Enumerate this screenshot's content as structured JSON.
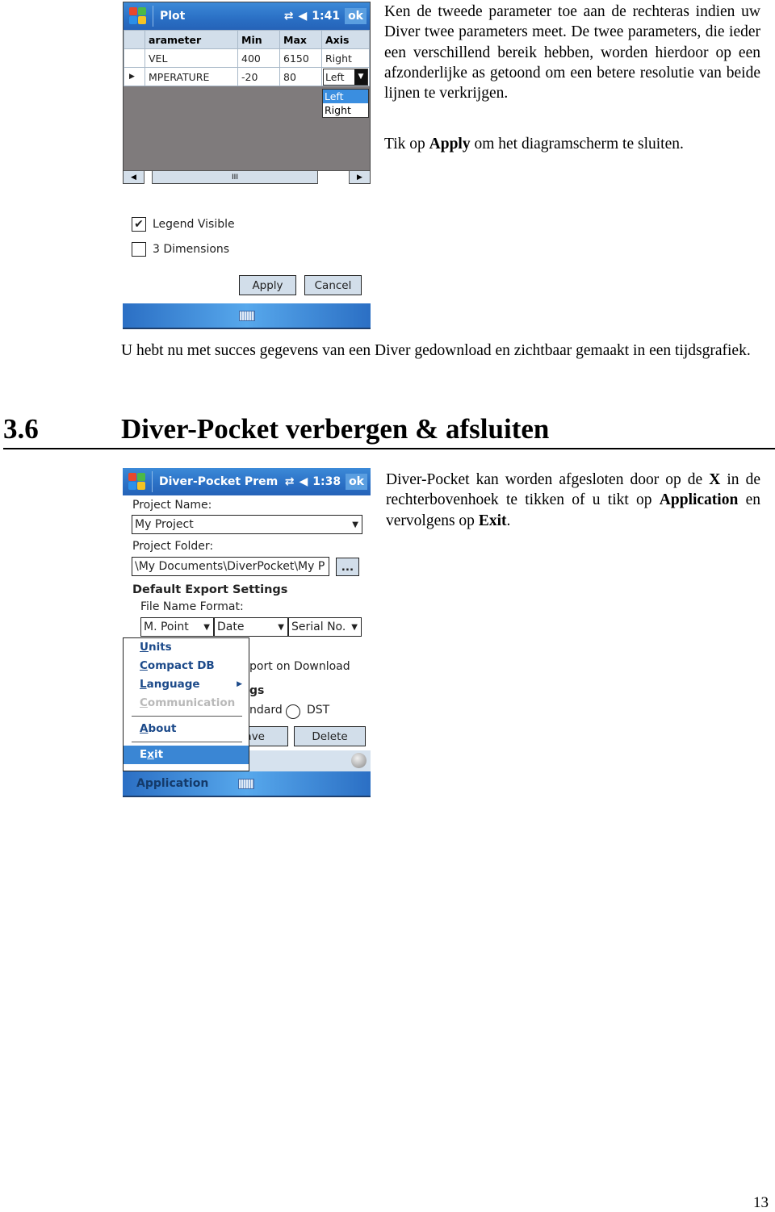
{
  "page_number": "13",
  "section1": {
    "screenshot": {
      "title_bar": {
        "title": "Plot",
        "time": "1:41",
        "ok_label": "ok",
        "connectivity_icon": "connectivity-icon",
        "volume_icon": "speaker-icon"
      },
      "grid": {
        "headers": [
          "arameter",
          "Min",
          "Max",
          "Axis"
        ],
        "rows": [
          {
            "parameter": "VEL",
            "min": "400",
            "max": "6150",
            "axis": "Right"
          },
          {
            "parameter": "MPERATURE",
            "min": "-20",
            "max": "80",
            "axis": "Left"
          }
        ],
        "dropdown_options": [
          "Left",
          "Right"
        ],
        "dropdown_selected": "Left"
      },
      "scroll_grip": "III"
    },
    "paragraph1": "Ken de tweede parameter toe aan de rechteras indien uw Diver twee parameters meet. De twee parameters, die ieder een verschillend bereik hebben, worden hierdoor op een afzonderlijke as getoond om een betere resolutie van beide lijnen te verkrijgen.",
    "paragraph2_pre": "Tik op ",
    "paragraph2_bold": "Apply",
    "paragraph2_post": " om het diagramscherm te sluiten."
  },
  "options_panel": {
    "legend_visible": {
      "label": "Legend Visible",
      "checked": true
    },
    "three_dimensions": {
      "label": "3 Dimensions",
      "checked": false
    },
    "apply_label": "Apply",
    "cancel_label": "Cancel"
  },
  "paragraph3": "U hebt nu met succes gegevens van een Diver gedownload en zichtbaar gemaakt in een tijdsgrafiek.",
  "section2": {
    "number": "3.6",
    "title": "Diver-Pocket verbergen & afsluiten",
    "screenshot": {
      "title_bar": {
        "title": "Diver-Pocket Prem",
        "time": "1:38",
        "ok_label": "ok"
      },
      "project_name_label": "Project Name:",
      "project_name_value": "My Project",
      "project_folder_label": "Project Folder:",
      "project_folder_value": "\\My Documents\\DiverPocket\\My P",
      "browse_label": "...",
      "export_heading": "Default Export Settings",
      "file_name_format_label": "File Name Format:",
      "format_fields": [
        "M. Point",
        "Date",
        "Serial No."
      ],
      "behind_text": {
        "export_on_download": "port on Download",
        "settings_fragment": "gs",
        "standard_fragment": "ndard",
        "dst_label": "DST",
        "save_fragment": "ave",
        "delete_label": "Delete"
      },
      "menu": {
        "items": [
          {
            "u": "U",
            "rest": "nits",
            "state": "normal"
          },
          {
            "u": "C",
            "rest": "ompact DB",
            "state": "normal"
          },
          {
            "u": "L",
            "rest": "anguage",
            "state": "normal",
            "submenu": true
          },
          {
            "u": "C",
            "rest": "ommunication",
            "state": "disabled"
          },
          {
            "u": "A",
            "rest": "bout",
            "state": "normal"
          },
          {
            "pre": "E",
            "u": "x",
            "rest": "it",
            "state": "active"
          }
        ]
      },
      "menubar_label": "Application"
    },
    "paragraph_pre": "Diver-Pocket kan worden afgesloten door op de ",
    "paragraph_b1": "X",
    "paragraph_mid": " in de rechterbovenhoek te tikken of u tikt op ",
    "paragraph_b2": "Application",
    "paragraph_mid2": " en vervolgens op ",
    "paragraph_b3": "Exit",
    "paragraph_end": "."
  }
}
